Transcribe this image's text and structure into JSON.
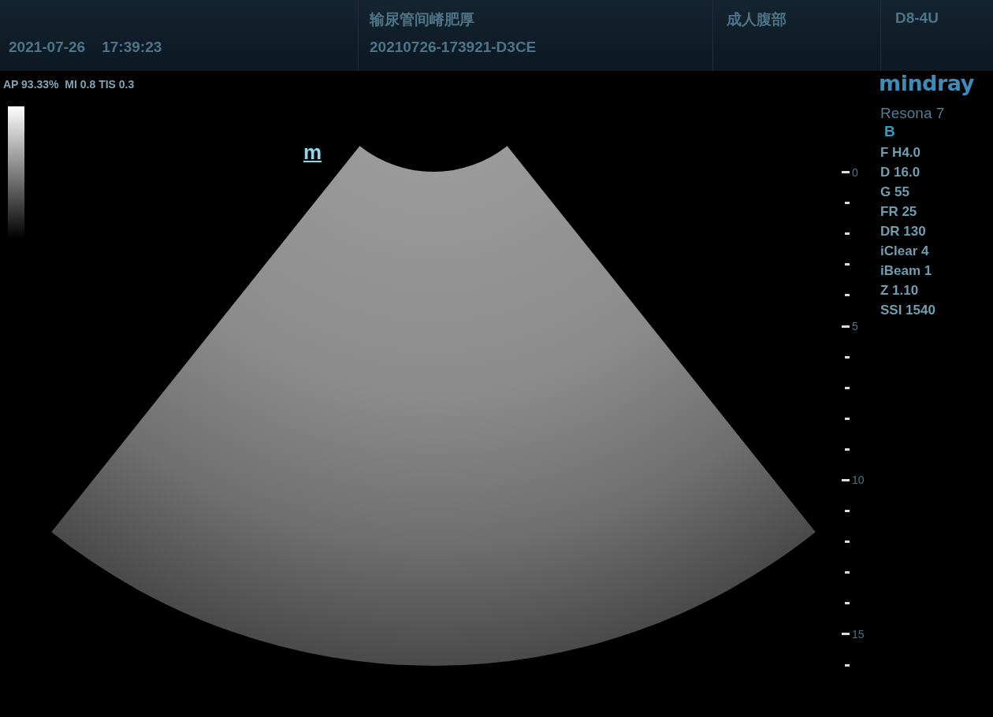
{
  "header": {
    "date": "2021-07-26",
    "time": "17:39:23",
    "exam_title": "输尿管间嵴肥厚",
    "exam_id": "20210726-173921-D3CE",
    "preset": "成人腹部",
    "probe": "D8-4U"
  },
  "acoustic_output": "AP 93.33%  MI 0.8 TIS 0.3",
  "orientation_mark": "m",
  "logo": "mindray",
  "system": {
    "model": "Resona 7",
    "mode": "B",
    "parameters": [
      "F H4.0",
      "D 16.0",
      "G 55",
      "FR 25",
      "DR 130",
      "iClear 4",
      "iBeam 1",
      "Z 1.10",
      "SSI 1540"
    ]
  },
  "depth_scale": {
    "labels": [
      "0",
      "5",
      "10",
      "15"
    ]
  }
}
